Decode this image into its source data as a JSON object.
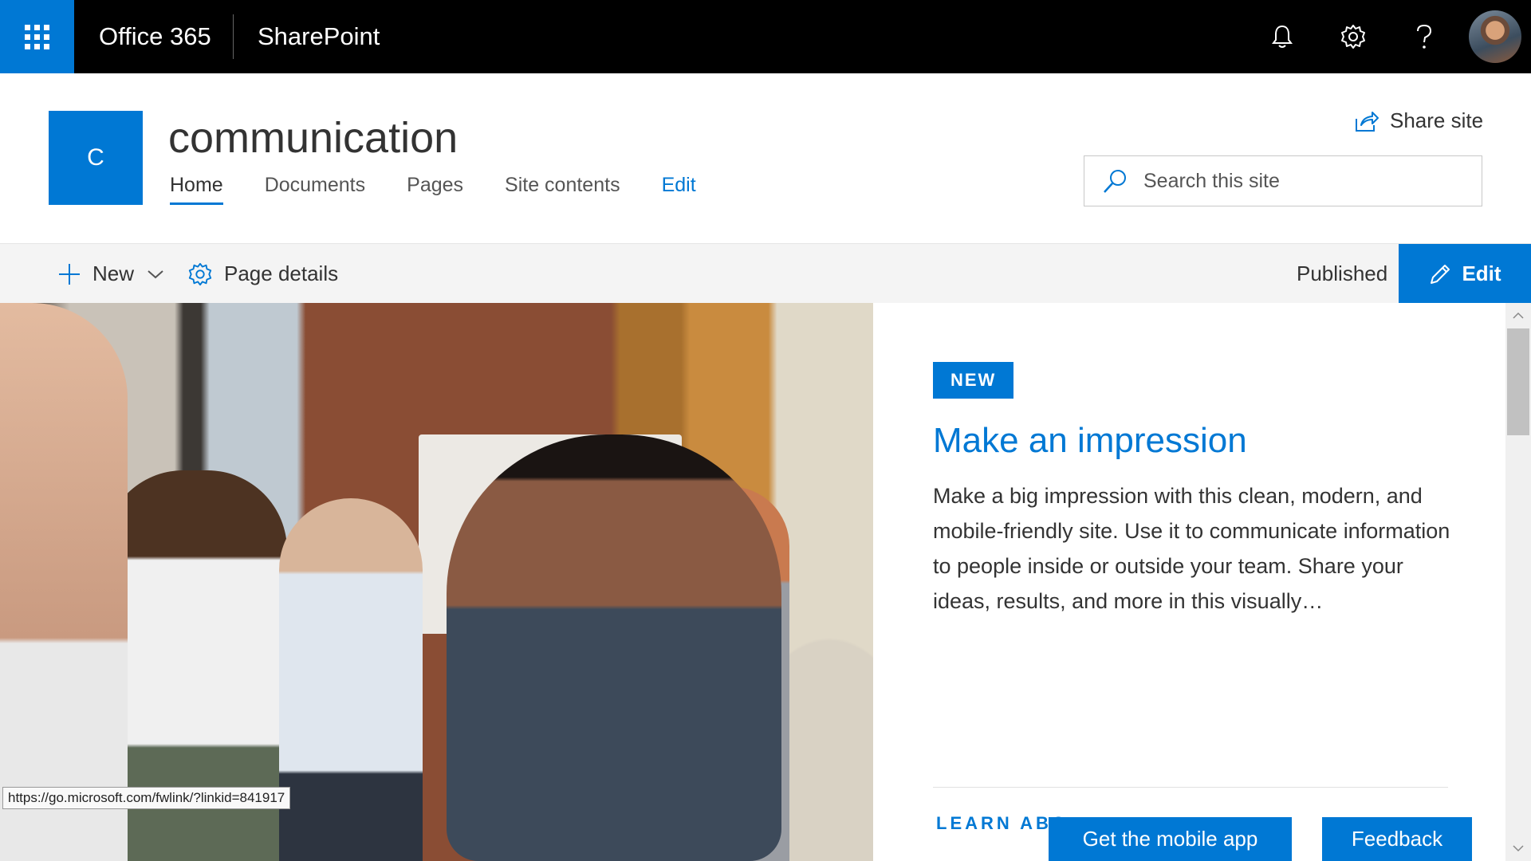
{
  "suite_bar": {
    "app_name": "Office 365",
    "product_name": "SharePoint",
    "icons": [
      "waffle-icon",
      "bell-icon",
      "gear-icon",
      "help-icon",
      "avatar"
    ]
  },
  "site": {
    "logo_letter": "C",
    "title": "communication",
    "nav": [
      {
        "label": "Home",
        "active": true
      },
      {
        "label": "Documents"
      },
      {
        "label": "Pages"
      },
      {
        "label": "Site contents"
      },
      {
        "label": "Edit"
      }
    ],
    "share_label": "Share site",
    "search_placeholder": "Search this site"
  },
  "command_bar": {
    "new_label": "New",
    "page_details_label": "Page details",
    "status": "Published",
    "edit_label": "Edit"
  },
  "hero": {
    "badge": "NEW",
    "heading": "Make an impression",
    "description": "Make a big impression with this clean, modern, and mobile-friendly site. Use it to communicate information to people inside or outside your team. Share your ideas, results, and more in this visually…",
    "learn_more": "LEARN ABO"
  },
  "status_tooltip": "https://go.microsoft.com/fwlink/?linkid=841917",
  "footer": {
    "mobile_app_label": "Get the mobile app",
    "feedback_label": "Feedback"
  },
  "colors": {
    "accent": "#0078d4",
    "suite_bar": "#000000",
    "command_bar": "#f4f4f4"
  }
}
